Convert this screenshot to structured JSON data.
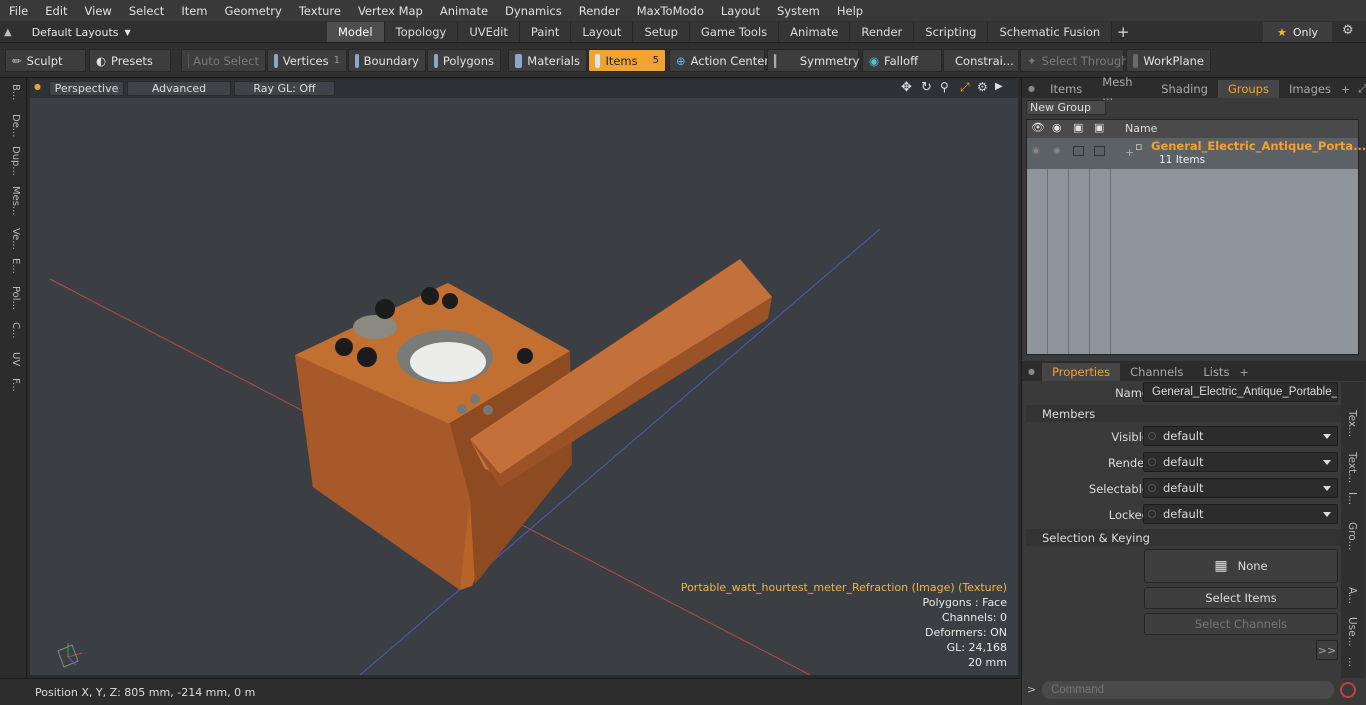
{
  "menu": [
    "File",
    "Edit",
    "View",
    "Select",
    "Item",
    "Geometry",
    "Texture",
    "Vertex Map",
    "Animate",
    "Dynamics",
    "Render",
    "MaxToModo",
    "Layout",
    "System",
    "Help"
  ],
  "layout_selector": "Default Layouts",
  "mode_tabs": [
    "Model",
    "Topology",
    "UVEdit",
    "Paint",
    "Layout",
    "Setup",
    "Game Tools",
    "Animate",
    "Render",
    "Scripting",
    "Schematic Fusion"
  ],
  "only_label": "Only",
  "toolbar": {
    "sculpt": "Sculpt",
    "presets": "Presets",
    "auto_select": "Auto Select",
    "vertices": "Vertices",
    "vertices_count": "1",
    "boundary": "Boundary",
    "polygons": "Polygons",
    "materials": "Materials",
    "items": "Items",
    "items_count": "5",
    "action_center": "Action Center",
    "symmetry": "Symmetry",
    "falloff": "Falloff",
    "constraints": "Constrai...",
    "select_through": "Select Through",
    "workplane": "WorkPlane"
  },
  "left_tabs": [
    "B...",
    "De...",
    "Dup...",
    "Mes...",
    "Ve...",
    "E...",
    "Pol...",
    "C...",
    "UV",
    "F..."
  ],
  "viewport": {
    "view": "Perspective",
    "shading": "Advanced",
    "raygl": "Ray GL: Off",
    "info": {
      "texture": "Portable_watt_hourtest_meter_Refraction (Image) (Texture)",
      "polygons": "Polygons : Face",
      "channels": "Channels: 0",
      "deformers": "Deformers: ON",
      "gl": "GL: 24,168",
      "scale": "20 mm"
    }
  },
  "status": {
    "position": "Position X, Y, Z:  805 mm, -214 mm, 0 m"
  },
  "top_panel": {
    "tabs": [
      "Items",
      "Mesh ...",
      "Shading",
      "Groups",
      "Images"
    ],
    "active_tab": "Groups",
    "new_group": "New Group",
    "name_col": "Name",
    "group_name": "General_Electric_Antique_Porta...",
    "group_items": "11 Items"
  },
  "props": {
    "tabs": [
      "Properties",
      "Channels",
      "Lists"
    ],
    "name_label": "Name",
    "name_value": "General_Electric_Antique_Portable_W",
    "members": "Members",
    "rows": [
      {
        "label": "Visible",
        "value": "default"
      },
      {
        "label": "Render",
        "value": "default"
      },
      {
        "label": "Selectable",
        "value": "default"
      },
      {
        "label": "Locked",
        "value": "default"
      }
    ],
    "sel_keying": "Selection & Keying",
    "none": "None",
    "select_items": "Select Items",
    "select_channels": "Select Channels",
    "more": ">>"
  },
  "right_tabs": [
    "Tex...",
    "Text...",
    "I...",
    "Gro...",
    "A...",
    "Use...",
    "..."
  ],
  "command_placeholder": "Command"
}
